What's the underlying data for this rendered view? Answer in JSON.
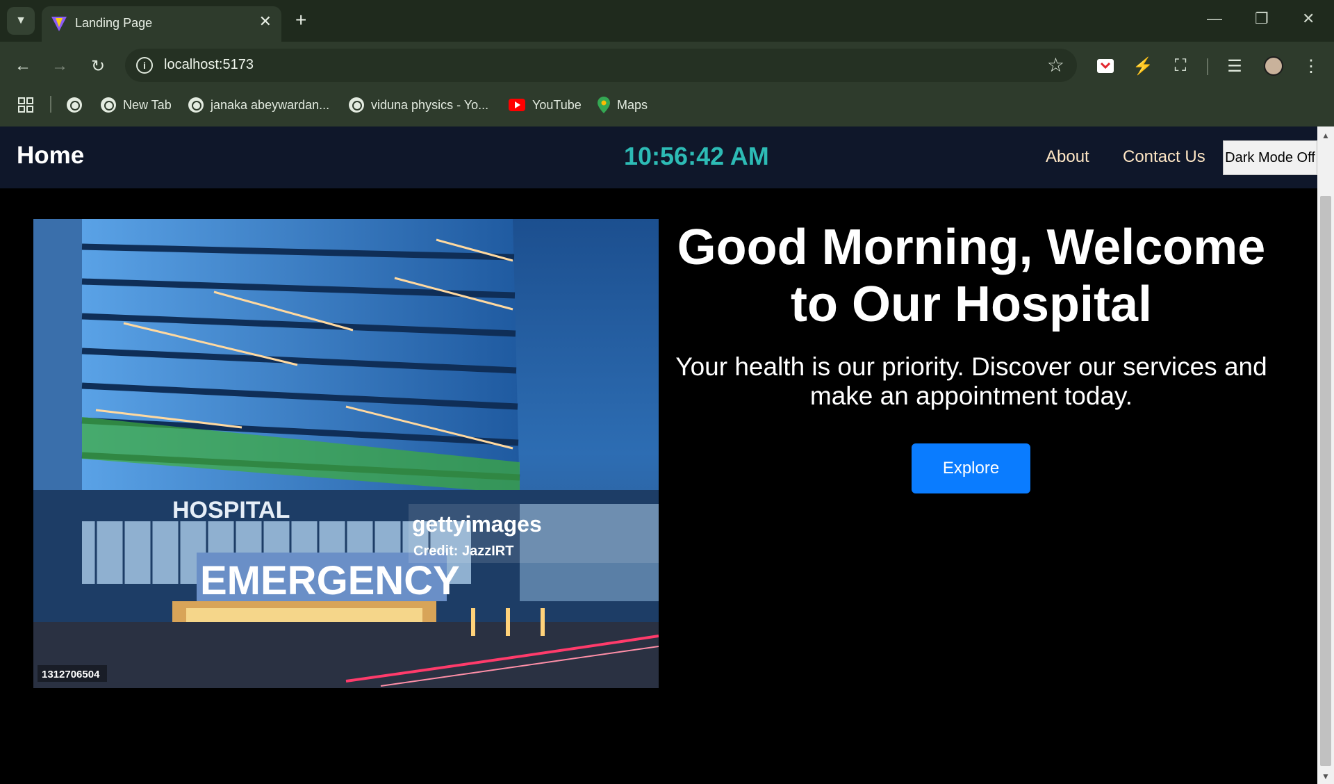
{
  "browser": {
    "tab_title": "Landing Page",
    "url": "localhost:5173",
    "bookmarks": [
      {
        "label": ""
      },
      {
        "label": "New Tab"
      },
      {
        "label": "janaka abeywardan..."
      },
      {
        "label": "viduna physics - Yo..."
      },
      {
        "label": "YouTube"
      },
      {
        "label": "Maps"
      }
    ]
  },
  "navbar": {
    "home": "Home",
    "clock": "10:56:42 AM",
    "about": "About",
    "contact": "Contact Us",
    "dark_mode": "Dark Mode Off"
  },
  "hero": {
    "title": "Good Morning, Welcome to Our Hospital",
    "subtitle": "Your health is our priority. Discover our services and make an appointment today.",
    "button": "Explore",
    "image": {
      "sign_hospital": "HOSPITAL",
      "sign_emergency": "EMERGENCY",
      "watermark": "gettyimages",
      "credit": "Credit: JazzIRT",
      "image_id": "1312706504"
    }
  },
  "colors": {
    "navbar_bg": "#0f172a",
    "clock": "#2dbbb5",
    "nav_link": "#ffe7c5",
    "button_bg": "#0a7cff",
    "page_bg": "#000000"
  }
}
